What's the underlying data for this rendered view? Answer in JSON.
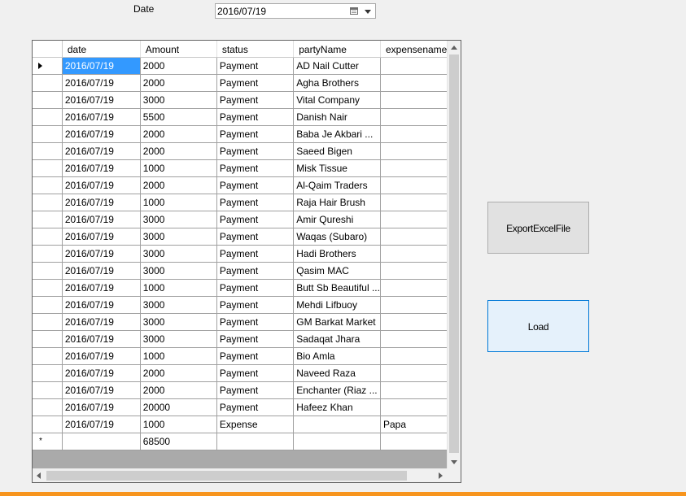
{
  "filter": {
    "date_label": "Date",
    "date_value": "2016/07/19"
  },
  "grid": {
    "columns": [
      "date",
      "Amount",
      "status",
      "partyName",
      "expensename"
    ],
    "rows": [
      {
        "date": "2016/07/19",
        "amount": "2000",
        "status": "Payment",
        "party": "AD Nail Cutter",
        "expense": ""
      },
      {
        "date": "2016/07/19",
        "amount": "2000",
        "status": "Payment",
        "party": "Agha Brothers",
        "expense": ""
      },
      {
        "date": "2016/07/19",
        "amount": "3000",
        "status": "Payment",
        "party": "Vital Company",
        "expense": ""
      },
      {
        "date": "2016/07/19",
        "amount": "5500",
        "status": "Payment",
        "party": "Danish Nair",
        "expense": ""
      },
      {
        "date": "2016/07/19",
        "amount": "2000",
        "status": "Payment",
        "party": "Baba Je Akbari ...",
        "expense": ""
      },
      {
        "date": "2016/07/19",
        "amount": "2000",
        "status": "Payment",
        "party": "Saeed Bigen",
        "expense": ""
      },
      {
        "date": "2016/07/19",
        "amount": "1000",
        "status": "Payment",
        "party": "Misk Tissue",
        "expense": ""
      },
      {
        "date": "2016/07/19",
        "amount": "2000",
        "status": "Payment",
        "party": "Al-Qaim Traders",
        "expense": ""
      },
      {
        "date": "2016/07/19",
        "amount": "1000",
        "status": "Payment",
        "party": "Raja Hair Brush",
        "expense": ""
      },
      {
        "date": "2016/07/19",
        "amount": "3000",
        "status": "Payment",
        "party": "Amir Qureshi",
        "expense": ""
      },
      {
        "date": "2016/07/19",
        "amount": "3000",
        "status": "Payment",
        "party": "Waqas (Subaro)",
        "expense": ""
      },
      {
        "date": "2016/07/19",
        "amount": "3000",
        "status": "Payment",
        "party": "Hadi Brothers",
        "expense": ""
      },
      {
        "date": "2016/07/19",
        "amount": "3000",
        "status": "Payment",
        "party": "Qasim MAC",
        "expense": ""
      },
      {
        "date": "2016/07/19",
        "amount": "1000",
        "status": "Payment",
        "party": "Butt Sb Beautiful ...",
        "expense": ""
      },
      {
        "date": "2016/07/19",
        "amount": "3000",
        "status": "Payment",
        "party": "Mehdi Lifbuoy",
        "expense": ""
      },
      {
        "date": "2016/07/19",
        "amount": "3000",
        "status": "Payment",
        "party": "GM Barkat Market",
        "expense": ""
      },
      {
        "date": "2016/07/19",
        "amount": "3000",
        "status": "Payment",
        "party": "Sadaqat Jhara",
        "expense": ""
      },
      {
        "date": "2016/07/19",
        "amount": "1000",
        "status": "Payment",
        "party": "Bio Amla",
        "expense": ""
      },
      {
        "date": "2016/07/19",
        "amount": "2000",
        "status": "Payment",
        "party": "Naveed Raza",
        "expense": ""
      },
      {
        "date": "2016/07/19",
        "amount": "2000",
        "status": "Payment",
        "party": "Enchanter (Riaz ...",
        "expense": ""
      },
      {
        "date": "2016/07/19",
        "amount": "20000",
        "status": "Payment",
        "party": "Hafeez Khan",
        "expense": ""
      },
      {
        "date": "2016/07/19",
        "amount": "1000",
        "status": "Expense",
        "party": "",
        "expense": "Papa"
      }
    ],
    "new_row": {
      "star": "*",
      "amount_total": "68500"
    }
  },
  "buttons": {
    "export_label": "ExportExcelFile",
    "load_label": "Load"
  },
  "colors": {
    "selection": "#3399ff",
    "accent_bar": "#f7941d",
    "load_button_border": "#0078d7"
  }
}
